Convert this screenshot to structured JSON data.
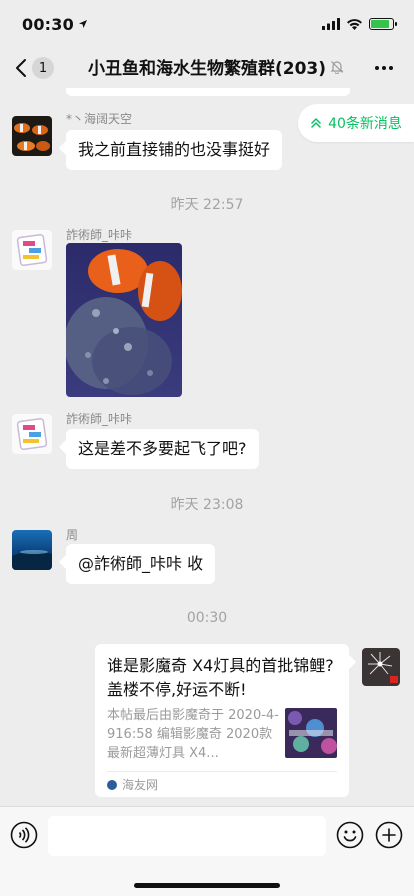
{
  "status_bar": {
    "time": "00:30",
    "battery_level": 0.85,
    "battery_color": "#36c24b"
  },
  "nav": {
    "unread_count": "1",
    "title": "小丑鱼和海水生物繁殖群(203)",
    "icons": {
      "back": "chevron-left-icon",
      "mute": "bell-muted-icon",
      "more": "more-dots-icon"
    }
  },
  "new_messages": {
    "label": "40条新消息",
    "color": "#07c160"
  },
  "messages": {
    "m1": {
      "sender": "*丶海阔天空",
      "text": "我之前直接铺的也没事挺好"
    },
    "ts1": "昨天 22:57",
    "m2": {
      "sender": "詐術師_咔咔",
      "type": "image"
    },
    "m3": {
      "sender": "詐術師_咔咔",
      "text": "这是差不多要起飞了吧?"
    },
    "ts2": "昨天 23:08",
    "m4": {
      "sender": "周",
      "text": "@詐術師_咔咔 收"
    },
    "ts3": "00:30",
    "m5": {
      "card_title": "谁是影魔奇 X4灯具的首批锦鲤?盖楼不停,好运不断!",
      "card_desc": "本帖最后由影魔奇于 2020-4-916:58 编辑影魔奇 2020款最新超薄灯具 X4...",
      "card_source": "海友网"
    }
  },
  "input_bar": {
    "placeholder": "",
    "icons": {
      "voice": "voice-icon",
      "emoji": "emoji-icon",
      "plus": "plus-icon"
    }
  }
}
